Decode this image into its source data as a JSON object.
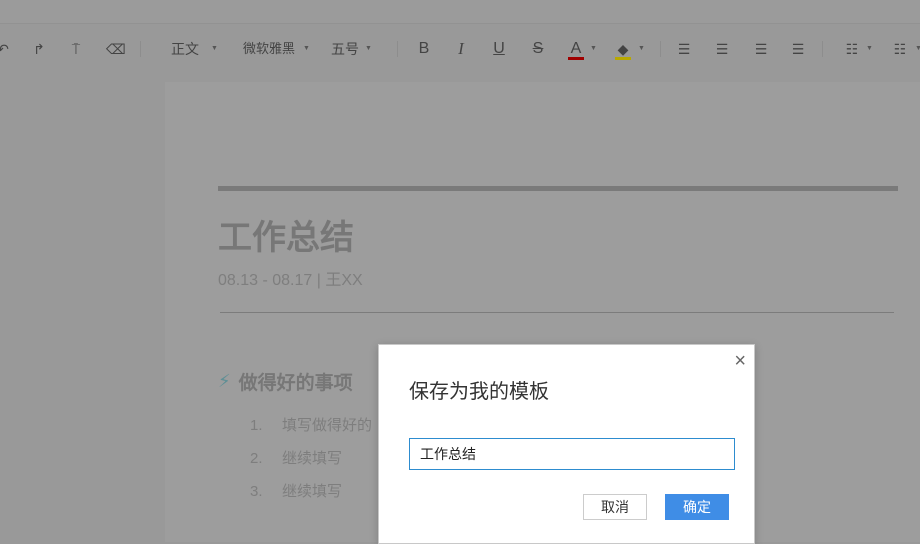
{
  "toolbar": {
    "style": "正文",
    "font": "微软雅黑",
    "size": "五号",
    "bold": "B",
    "italic": "I",
    "underline": "U",
    "strike": "S",
    "font_color": "A",
    "font_color_hex": "#c00000",
    "highlight_hex": "#d4c000"
  },
  "document": {
    "title": "工作总结",
    "subtitle": "08.13 - 08.17 | 王XX",
    "section_heading": "做得好的事项",
    "items": [
      {
        "num": "1.",
        "text": "填写做得好的"
      },
      {
        "num": "2.",
        "text": "继续填写"
      },
      {
        "num": "3.",
        "text": "继续填写"
      }
    ]
  },
  "dialog": {
    "title": "保存为我的模板",
    "input_value": "工作总结",
    "cancel": "取消",
    "ok": "确定",
    "close": "×"
  }
}
